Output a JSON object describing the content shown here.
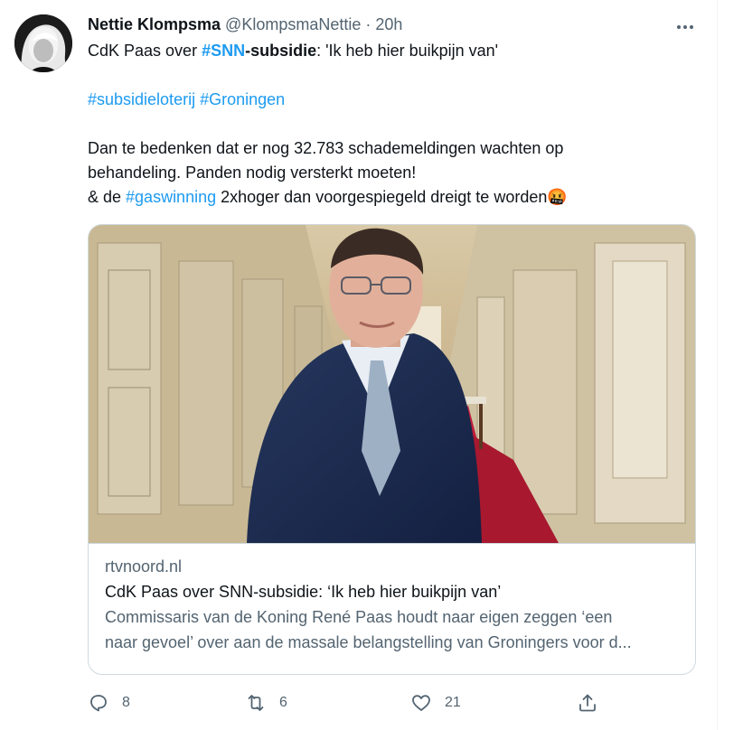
{
  "tweet": {
    "author_name": "Nettie Klompsma",
    "author_handle": "@KlompsmaNettie",
    "separator": "·",
    "time": "20h",
    "line1_prefix": "CdK Paas over ",
    "line1_hashtag": "#SNN",
    "line1_bold_suffix": "-subsidie",
    "line1_rest": ": 'Ik heb hier buikpijn van'",
    "hashtag_1": "#subsidieloterij",
    "hashtag_2": "#Groningen",
    "para_line1": "Dan te bedenken dat er nog 32.783 schademeldingen wachten op",
    "para_line2": "behandeling. Panden nodig versterkt moeten!",
    "para_line3_prefix": "& de ",
    "para_line3_hashtag": "#gaswinning",
    "para_line3_rest": " 2xhoger dan voorgespiegeld dreigt te worden",
    "emoji": "🤬"
  },
  "card": {
    "domain": "rtvnoord.nl",
    "title": "CdK Paas over SNN-subsidie: ‘Ik heb hier buikpijn van’",
    "description_line1": "Commissaris van de Koning René Paas houdt naar eigen zeggen ‘een",
    "description_line2": "naar gevoel’ over aan de massale belangstelling van Groningers voor d..."
  },
  "actions": {
    "replies": "8",
    "retweets": "6",
    "likes": "21"
  },
  "colors": {
    "link": "#1d9bf0",
    "secondary_text": "#536471",
    "primary_text": "#0f1419",
    "border": "#cfd9de"
  },
  "icons": [
    "more-icon",
    "reply-icon",
    "retweet-icon",
    "like-icon",
    "share-icon",
    "angry-face-emoji"
  ]
}
